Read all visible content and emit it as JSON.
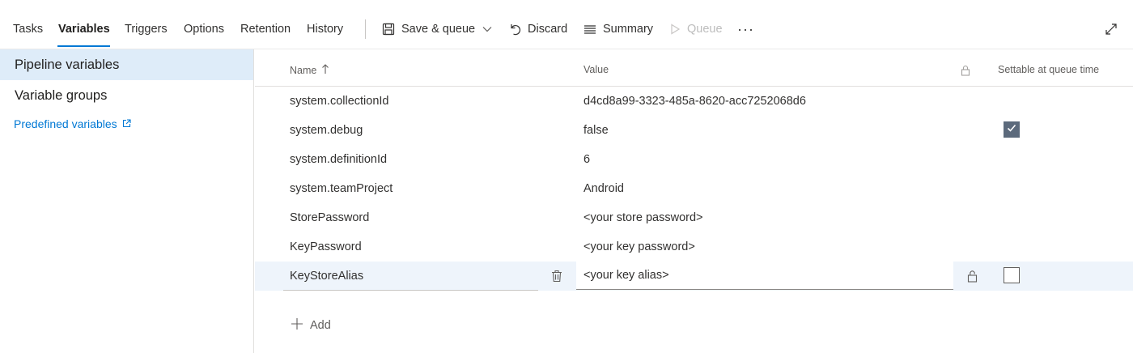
{
  "tabs": [
    {
      "label": "Tasks"
    },
    {
      "label": "Variables"
    },
    {
      "label": "Triggers"
    },
    {
      "label": "Options"
    },
    {
      "label": "Retention"
    },
    {
      "label": "History"
    }
  ],
  "active_tab": "Variables",
  "toolbar": {
    "save_queue_label": "Save & queue",
    "discard_label": "Discard",
    "summary_label": "Summary",
    "queue_label": "Queue",
    "more_label": "···"
  },
  "sidebar": {
    "items": [
      {
        "label": "Pipeline variables",
        "selected": true
      },
      {
        "label": "Variable groups",
        "selected": false
      }
    ],
    "predefined_link": "Predefined variables"
  },
  "grid": {
    "columns": {
      "name": "Name",
      "value": "Value",
      "settable": "Settable at queue time"
    },
    "sort": {
      "column": "Name",
      "direction": "ascending"
    },
    "rows": [
      {
        "name": "system.collectionId",
        "value": "d4cd8a99-3323-485a-8620-acc7252068d6",
        "settable": false
      },
      {
        "name": "system.debug",
        "value": "false",
        "settable": true
      },
      {
        "name": "system.definitionId",
        "value": "6",
        "settable": false
      },
      {
        "name": "system.teamProject",
        "value": "Android",
        "settable": false
      },
      {
        "name": "StorePassword",
        "value": "<your store password>",
        "settable": false
      },
      {
        "name": "KeyPassword",
        "value": "<your key password>",
        "settable": false
      },
      {
        "name": "KeyStoreAlias",
        "value": "<your key alias>",
        "settable": false,
        "editing": true
      }
    ],
    "add_label": "Add"
  },
  "colors": {
    "accent": "#0078d4",
    "selected_nav_bg": "#deecf9",
    "selected_row_bg": "#eef4fb",
    "checkbox_checked": "#5c6a7c"
  }
}
